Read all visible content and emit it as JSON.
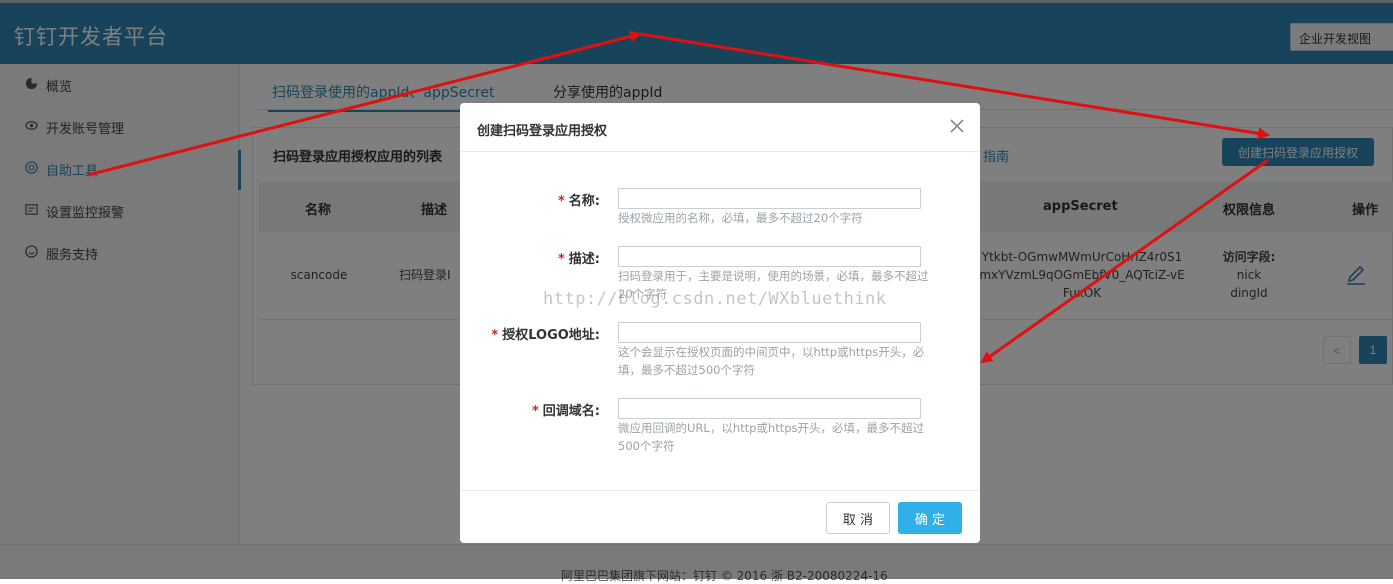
{
  "header": {
    "title": "钉钉开发者平台",
    "view_button": "企业开发视图"
  },
  "sidebar": {
    "items": [
      {
        "label": "概览",
        "icon": "pie-chart-icon"
      },
      {
        "label": "开发账号管理",
        "icon": "eye-icon"
      },
      {
        "label": "自助工具",
        "icon": "target-icon",
        "active": true
      },
      {
        "label": "设置监控报警",
        "icon": "monitor-icon"
      },
      {
        "label": "服务支持",
        "icon": "smile-icon"
      }
    ]
  },
  "main": {
    "tabs": [
      {
        "label": "扫码登录使用的appId、appSecret",
        "active": true
      },
      {
        "label": "分享使用的appId",
        "active": false
      }
    ],
    "panel": {
      "title": "扫码登录应用授权应用的列表",
      "guide_link": "指南",
      "create_button": "创建扫码登录应用授权",
      "columns": [
        "名称",
        "描述",
        "appSecret",
        "权限信息",
        "操作"
      ],
      "rows": [
        {
          "name": "scancode",
          "desc": "扫码登录I",
          "secret_lines": [
            "Ytkbt-OGmwMWmUrCoHrlZ4r0S1",
            "mxYVzmL9qOGmEbfV0_AQTciZ-vE",
            "FuxOK"
          ],
          "perm_label": "访问字段:",
          "perm_values": [
            "nick",
            "dingId"
          ]
        }
      ],
      "pager": {
        "prev": "<",
        "current": "1"
      }
    }
  },
  "footer": {
    "text": "阿里巴巴集团旗下网站：钉钉 © 2016 浙 B2-20080224-16"
  },
  "modal": {
    "title": "创建扫码登录应用授权",
    "fields": [
      {
        "label": "名称:",
        "value": "",
        "hint": "授权微应用的名称，必填，最多不超过20个字符"
      },
      {
        "label": "描述:",
        "value": "",
        "hint_lines": [
          "扫码登录用于，主要是说明，使用的场景，必填，最多不超过",
          "20个字符"
        ]
      },
      {
        "label": "授权LOGO地址:",
        "value": "",
        "hint_lines": [
          "这个会显示在授权页面的中间页中，以http或https开头，必",
          "填，最多不超过500个字符"
        ]
      },
      {
        "label": "回调域名:",
        "value": "",
        "hint_lines": [
          "微应用回调的URL，以http或https开头，必填，最多不超过",
          "500个字符"
        ]
      }
    ],
    "required_mark": "*",
    "cancel_label": "取 消",
    "ok_label": "确 定"
  },
  "watermark": "http://blog.csdn.net/WXbluethink",
  "colors": {
    "brand": "#2f88b4",
    "confirm": "#31b0e8",
    "arrow": "#e01010",
    "required": "#e02020"
  }
}
